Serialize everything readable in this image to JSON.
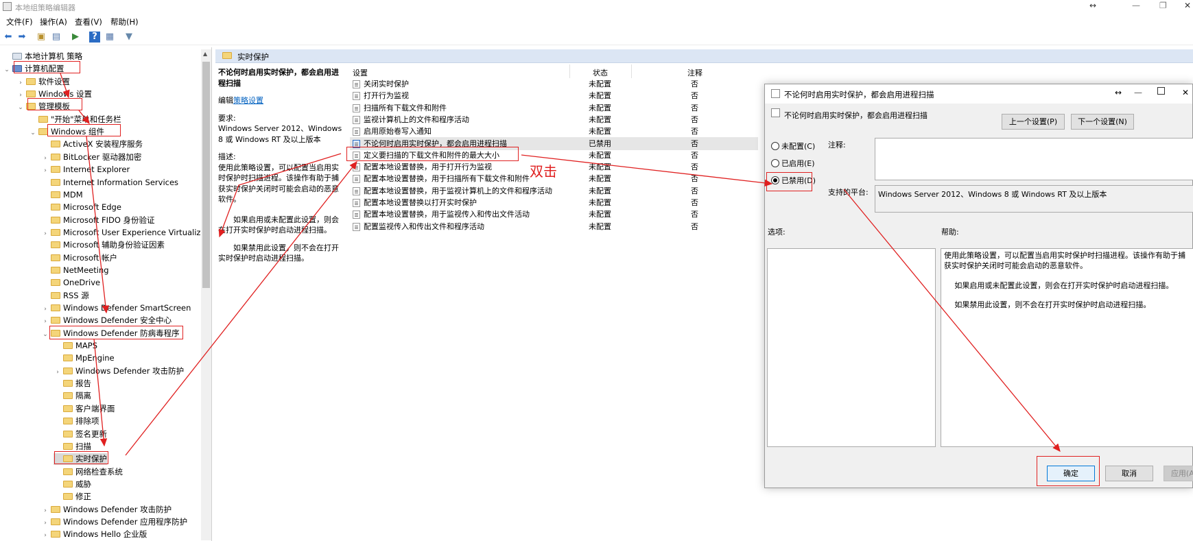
{
  "window": {
    "title": "本地组策略编辑器",
    "resize_icon": "↔",
    "min_icon": "—",
    "max_icon": "❐",
    "close_icon": "✕"
  },
  "menu": [
    "文件(F)",
    "操作(A)",
    "查看(V)",
    "帮助(H)"
  ],
  "tree": {
    "items": [
      {
        "label": "本地计算机 策略",
        "level": 0,
        "exp": ""
      },
      {
        "label": "计算机配置",
        "level": 0,
        "exp": "v"
      },
      {
        "label": "软件设置",
        "level": 1,
        "exp": ">"
      },
      {
        "label": "Windows 设置",
        "level": 1,
        "exp": ">"
      },
      {
        "label": "管理模板",
        "level": 1,
        "exp": "v"
      },
      {
        "label": "\"开始\"菜单和任务栏",
        "level": 2,
        "exp": ""
      },
      {
        "label": "Windows 组件",
        "level": 2,
        "exp": "v"
      },
      {
        "label": "ActiveX 安装程序服务",
        "level": 3,
        "exp": ""
      },
      {
        "label": "BitLocker 驱动器加密",
        "level": 3,
        "exp": ">"
      },
      {
        "label": "Internet Explorer",
        "level": 3,
        "exp": ">"
      },
      {
        "label": "Internet Information Services",
        "level": 3,
        "exp": ""
      },
      {
        "label": "MDM",
        "level": 3,
        "exp": ""
      },
      {
        "label": "Microsoft Edge",
        "level": 3,
        "exp": ""
      },
      {
        "label": "Microsoft FIDO 身份验证",
        "level": 3,
        "exp": ""
      },
      {
        "label": "Microsoft User Experience Virtualizati",
        "level": 3,
        "exp": ">"
      },
      {
        "label": "Microsoft 辅助身份验证因素",
        "level": 3,
        "exp": ""
      },
      {
        "label": "Microsoft 帐户",
        "level": 3,
        "exp": ""
      },
      {
        "label": "NetMeeting",
        "level": 3,
        "exp": ""
      },
      {
        "label": "OneDrive",
        "level": 3,
        "exp": ""
      },
      {
        "label": "RSS 源",
        "level": 3,
        "exp": ""
      },
      {
        "label": "Windows Defender SmartScreen",
        "level": 3,
        "exp": ">"
      },
      {
        "label": "Windows Defender 安全中心",
        "level": 3,
        "exp": ">"
      },
      {
        "label": "Windows Defender 防病毒程序",
        "level": 3,
        "exp": "v"
      },
      {
        "label": "MAPS",
        "level": 4,
        "exp": ""
      },
      {
        "label": "MpEngine",
        "level": 4,
        "exp": ""
      },
      {
        "label": "Windows Defender 攻击防护",
        "level": 4,
        "exp": ">"
      },
      {
        "label": "报告",
        "level": 4,
        "exp": ""
      },
      {
        "label": "隔离",
        "level": 4,
        "exp": ""
      },
      {
        "label": "客户端界面",
        "level": 4,
        "exp": ""
      },
      {
        "label": "排除项",
        "level": 4,
        "exp": ""
      },
      {
        "label": "签名更新",
        "level": 4,
        "exp": ""
      },
      {
        "label": "扫描",
        "level": 4,
        "exp": ""
      },
      {
        "label": "实时保护",
        "level": 4,
        "exp": ""
      },
      {
        "label": "网络检查系统",
        "level": 4,
        "exp": ""
      },
      {
        "label": "威胁",
        "level": 4,
        "exp": ""
      },
      {
        "label": "修正",
        "level": 4,
        "exp": ""
      },
      {
        "label": "Windows Defender 攻击防护",
        "level": 3,
        "exp": ">"
      },
      {
        "label": "Windows Defender 应用程序防护",
        "level": 3,
        "exp": ">"
      },
      {
        "label": "Windows Hello 企业版",
        "level": 3,
        "exp": ">"
      }
    ]
  },
  "right_header": "实时保护",
  "desc": {
    "title": "不论何时启用实时保护，都会启用进程扫描",
    "edit_prefix": "编辑",
    "edit_link": "策略设置",
    "req_label": "要求:",
    "req_text": "Windows Server 2012、Windows 8 或 Windows RT 及以上版本",
    "desc_label": "描述:",
    "p1": "使用此策略设置，可以配置当启用实时保护时扫描进程。该操作有助于捕获实时保护关闭时可能会启动的恶意软件。",
    "p2": "如果启用或未配置此设置，则会在打开实时保护时启动进程扫描。",
    "p3": "如果禁用此设置，则不会在打开实时保护时启动进程扫描。"
  },
  "list": {
    "headers": {
      "setting": "设置",
      "state": "状态",
      "note": "注释"
    },
    "rows": [
      {
        "name": "关闭实时保护",
        "state": "未配置",
        "note": "否"
      },
      {
        "name": "打开行为监视",
        "state": "未配置",
        "note": "否"
      },
      {
        "name": "扫描所有下载文件和附件",
        "state": "未配置",
        "note": "否"
      },
      {
        "name": "监视计算机上的文件和程序活动",
        "state": "未配置",
        "note": "否"
      },
      {
        "name": "启用原始卷写入通知",
        "state": "未配置",
        "note": "否"
      },
      {
        "name": "不论何时启用实时保护，都会启用进程扫描",
        "state": "已禁用",
        "note": "否"
      },
      {
        "name": "定义要扫描的下载文件和附件的最大大小",
        "state": "未配置",
        "note": "否"
      },
      {
        "name": "配置本地设置替换，用于打开行为监视",
        "state": "未配置",
        "note": "否"
      },
      {
        "name": "配置本地设置替换，用于扫描所有下载文件和附件",
        "state": "未配置",
        "note": "否"
      },
      {
        "name": "配置本地设置替换，用于监视计算机上的文件和程序活动",
        "state": "未配置",
        "note": "否"
      },
      {
        "name": "配置本地设置替换以打开实时保护",
        "state": "未配置",
        "note": "否"
      },
      {
        "name": "配置本地设置替换，用于监视传入和传出文件活动",
        "state": "未配置",
        "note": "否"
      },
      {
        "name": "配置监视传入和传出文件和程序活动",
        "state": "未配置",
        "note": "否"
      }
    ]
  },
  "annotation": "双击",
  "dialog": {
    "title": "不论何时启用实时保护，都会启用进程扫描",
    "subtitle": "不论何时启用实时保护，都会启用进程扫描",
    "prev": "上一个设置(P)",
    "next": "下一个设置(N)",
    "radio_notconfig": "未配置(C)",
    "radio_enabled": "已启用(E)",
    "radio_disabled": "已禁用(D)",
    "comment_label": "注释:",
    "platform_label": "支持的平台:",
    "platform_text": "Windows Server 2012、Windows 8 或 Windows RT 及以上版本",
    "options_label": "选项:",
    "help_label": "帮助:",
    "help_p1": "使用此策略设置，可以配置当启用实时保护时扫描进程。该操作有助于捕获实时保护关闭时可能会启动的恶意软件。",
    "help_p2": "如果启用或未配置此设置，则会在打开实时保护时启动进程扫描。",
    "help_p3": "如果禁用此设置，则不会在打开实时保护时启动进程扫描。",
    "ok": "确定",
    "cancel": "取消",
    "apply": "应用(A)"
  }
}
